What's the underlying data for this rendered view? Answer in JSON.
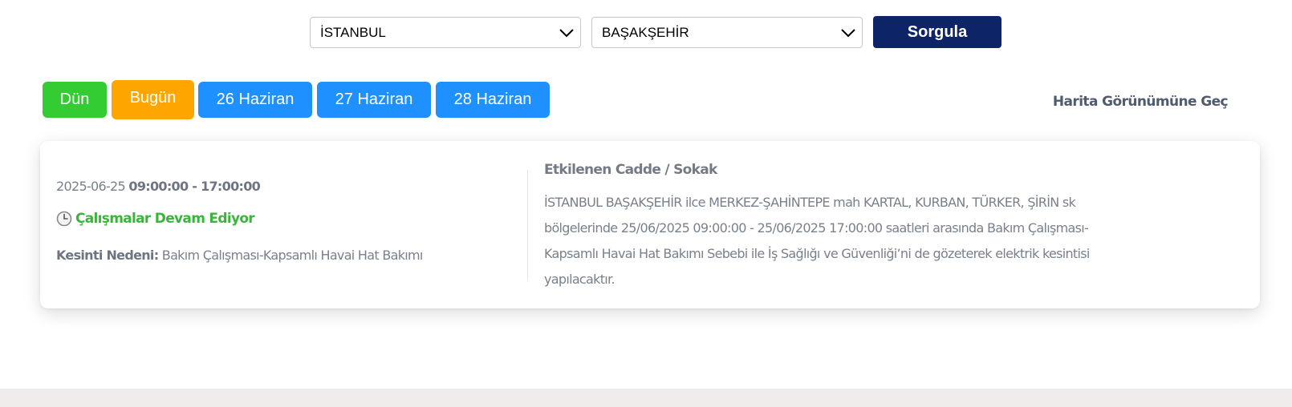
{
  "search": {
    "city": {
      "selected": "İSTANBUL"
    },
    "district": {
      "selected": "BAŞAKŞEHİR"
    },
    "query_label": "Sorgula"
  },
  "day_tabs": [
    {
      "label": "Dün",
      "color": "#33cc33"
    },
    {
      "label": "Bugün",
      "color": "#ffa500"
    },
    {
      "label": "26 Haziran",
      "color": "#1e90ff"
    },
    {
      "label": "27 Haziran",
      "color": "#1e90ff"
    },
    {
      "label": "28 Haziran",
      "color": "#1e90ff"
    }
  ],
  "map_view_label": "Harita Görünümüne Geç",
  "outage": {
    "date": "2025-06-25",
    "time_range": "09:00:00 - 17:00:00",
    "status_icon": "clock-icon",
    "status": "Çalışmalar Devam Ediyor",
    "status_color": "#3cb33c",
    "reason_label": "Kesinti Nedeni:",
    "reason": "Bakım Çalışması-Kapsamlı Havai Hat Bakımı",
    "streets_heading": "Etkilenen Cadde / Sokak",
    "streets_description": "İSTANBUL BAŞAKŞEHİR ilce MERKEZ-ŞAHİNTEPE mah KARTAL, KURBAN, TÜRKER, ŞİRİN sk bölgelerinde 25/06/2025 09:00:00 - 25/06/2025 17:00:00 saatleri arasında Bakım Çalışması-Kapsamlı Havai Hat Bakımı Sebebi ile İş Sağlığı ve Güvenliği’ni de gözeterek elektrik kesintisi yapılacaktır."
  },
  "colors": {
    "query_button": "#0d2466",
    "map_link": "#4f5b6e",
    "footer_band": "#f1ecec"
  }
}
